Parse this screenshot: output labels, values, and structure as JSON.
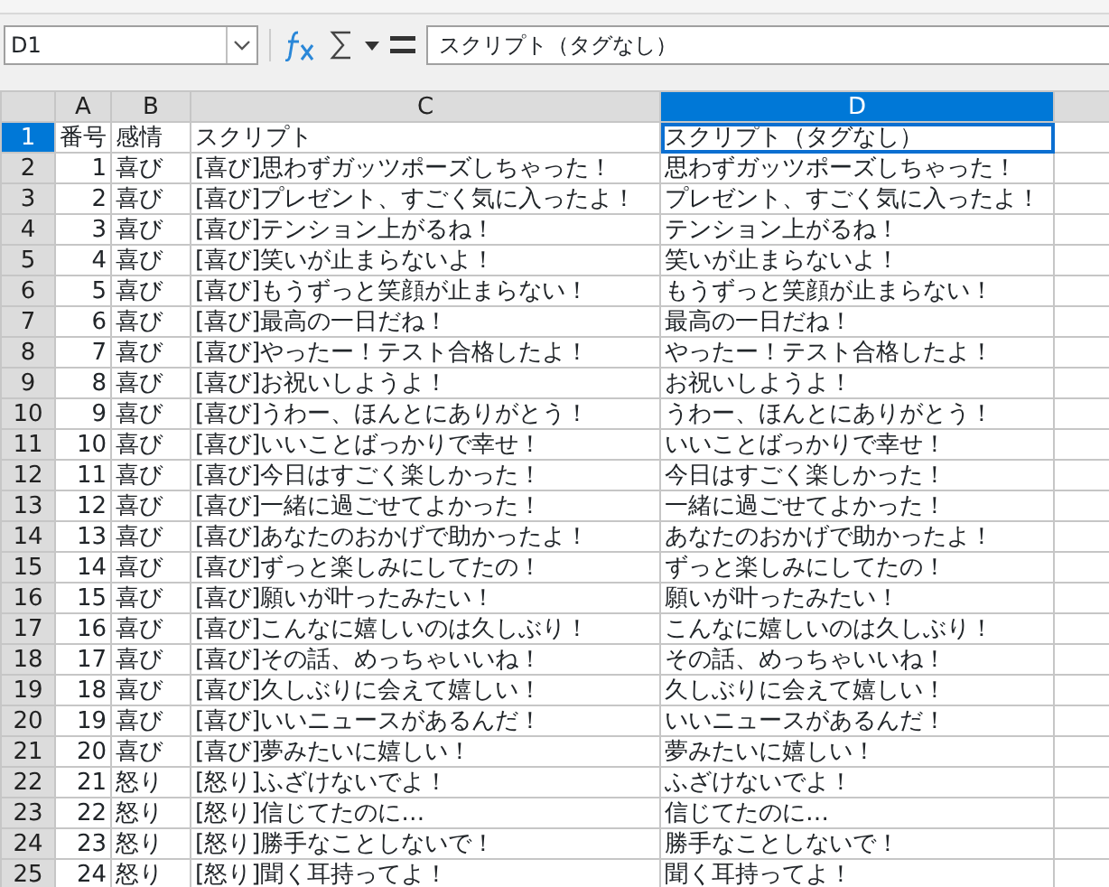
{
  "name_box": {
    "value": "D1"
  },
  "formula_bar": {
    "value": "スクリプト（タグなし）"
  },
  "columns": [
    {
      "label": "A",
      "selected": false
    },
    {
      "label": "B",
      "selected": false
    },
    {
      "label": "C",
      "selected": false
    },
    {
      "label": "D",
      "selected": true
    }
  ],
  "rows": [
    {
      "number": "1",
      "selected": true,
      "cells": [
        "番号",
        "感情",
        "スクリプト",
        "スクリプト（タグなし）"
      ]
    },
    {
      "number": "2",
      "selected": false,
      "cells": [
        "1",
        "喜び",
        "[喜び]思わずガッツポーズしちゃった！",
        "思わずガッツポーズしちゃった！"
      ]
    },
    {
      "number": "3",
      "selected": false,
      "cells": [
        "2",
        "喜び",
        "[喜び]プレゼント、すごく気に入ったよ！",
        "プレゼント、すごく気に入ったよ！"
      ]
    },
    {
      "number": "4",
      "selected": false,
      "cells": [
        "3",
        "喜び",
        "[喜び]テンション上がるね！",
        "テンション上がるね！"
      ]
    },
    {
      "number": "5",
      "selected": false,
      "cells": [
        "4",
        "喜び",
        "[喜び]笑いが止まらないよ！",
        "笑いが止まらないよ！"
      ]
    },
    {
      "number": "6",
      "selected": false,
      "cells": [
        "5",
        "喜び",
        "[喜び]もうずっと笑顔が止まらない！",
        "もうずっと笑顔が止まらない！"
      ]
    },
    {
      "number": "7",
      "selected": false,
      "cells": [
        "6",
        "喜び",
        "[喜び]最高の一日だね！",
        "最高の一日だね！"
      ]
    },
    {
      "number": "8",
      "selected": false,
      "cells": [
        "7",
        "喜び",
        "[喜び]やったー！テスト合格したよ！",
        "やったー！テスト合格したよ！"
      ]
    },
    {
      "number": "9",
      "selected": false,
      "cells": [
        "8",
        "喜び",
        "[喜び]お祝いしようよ！",
        "お祝いしようよ！"
      ]
    },
    {
      "number": "10",
      "selected": false,
      "cells": [
        "9",
        "喜び",
        "[喜び]うわー、ほんとにありがとう！",
        "うわー、ほんとにありがとう！"
      ]
    },
    {
      "number": "11",
      "selected": false,
      "cells": [
        "10",
        "喜び",
        "[喜び]いいことばっかりで幸せ！",
        "いいことばっかりで幸せ！"
      ]
    },
    {
      "number": "12",
      "selected": false,
      "cells": [
        "11",
        "喜び",
        "[喜び]今日はすごく楽しかった！",
        "今日はすごく楽しかった！"
      ]
    },
    {
      "number": "13",
      "selected": false,
      "cells": [
        "12",
        "喜び",
        "[喜び]一緒に過ごせてよかった！",
        "一緒に過ごせてよかった！"
      ]
    },
    {
      "number": "14",
      "selected": false,
      "cells": [
        "13",
        "喜び",
        "[喜び]あなたのおかげで助かったよ！",
        "あなたのおかげで助かったよ！"
      ]
    },
    {
      "number": "15",
      "selected": false,
      "cells": [
        "14",
        "喜び",
        "[喜び]ずっと楽しみにしてたの！",
        "ずっと楽しみにしてたの！"
      ]
    },
    {
      "number": "16",
      "selected": false,
      "cells": [
        "15",
        "喜び",
        "[喜び]願いが叶ったみたい！",
        "願いが叶ったみたい！"
      ]
    },
    {
      "number": "17",
      "selected": false,
      "cells": [
        "16",
        "喜び",
        "[喜び]こんなに嬉しいのは久しぶり！",
        "こんなに嬉しいのは久しぶり！"
      ]
    },
    {
      "number": "18",
      "selected": false,
      "cells": [
        "17",
        "喜び",
        "[喜び]その話、めっちゃいいね！",
        "その話、めっちゃいいね！"
      ]
    },
    {
      "number": "19",
      "selected": false,
      "cells": [
        "18",
        "喜び",
        "[喜び]久しぶりに会えて嬉しい！",
        "久しぶりに会えて嬉しい！"
      ]
    },
    {
      "number": "20",
      "selected": false,
      "cells": [
        "19",
        "喜び",
        "[喜び]いいニュースがあるんだ！",
        "いいニュースがあるんだ！"
      ]
    },
    {
      "number": "21",
      "selected": false,
      "cells": [
        "20",
        "喜び",
        "[喜び]夢みたいに嬉しい！",
        "夢みたいに嬉しい！"
      ]
    },
    {
      "number": "22",
      "selected": false,
      "cells": [
        "21",
        "怒り",
        "[怒り]ふざけないでよ！",
        "ふざけないでよ！"
      ]
    },
    {
      "number": "23",
      "selected": false,
      "cells": [
        "22",
        "怒り",
        "[怒り]信じてたのに…",
        "信じてたのに…"
      ]
    },
    {
      "number": "24",
      "selected": false,
      "cells": [
        "23",
        "怒り",
        "[怒り]勝手なことしないで！",
        "勝手なことしないで！"
      ]
    },
    {
      "number": "25",
      "selected": false,
      "cells": [
        "24",
        "怒り",
        "[怒り]聞く耳持ってよ！",
        "聞く耳持ってよ！"
      ]
    }
  ]
}
